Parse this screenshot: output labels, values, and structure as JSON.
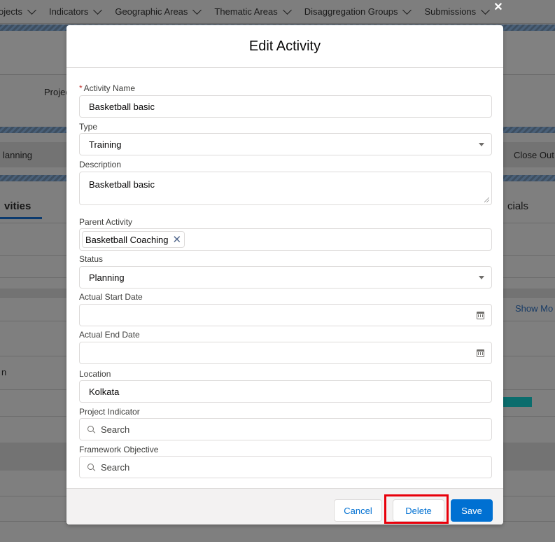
{
  "topnav": {
    "items": [
      "ojects",
      "Indicators",
      "Geographic Areas",
      "Thematic Areas",
      "Disaggregation Groups",
      "Submissions"
    ]
  },
  "background": {
    "project_label": "Projec",
    "stage_left": "lanning",
    "stage_right": "Close Out",
    "tab_left": "vities",
    "tab_right": "cials",
    "show_more": "Show Mo",
    "partial_char": "n"
  },
  "modal": {
    "title": "Edit Activity",
    "close_glyph": "✕",
    "fields": {
      "activity_name": {
        "label": "Activity Name",
        "required": "*",
        "value": "Basketball basic"
      },
      "type": {
        "label": "Type",
        "value": "Training"
      },
      "description": {
        "label": "Description",
        "value": "Basketball basic"
      },
      "parent_activity": {
        "label": "Parent Activity",
        "pill": "Basketball Coaching",
        "pill_remove": "✕"
      },
      "status": {
        "label": "Status",
        "value": "Planning"
      },
      "actual_start_date": {
        "label": "Actual Start Date",
        "value": ""
      },
      "actual_end_date": {
        "label": "Actual End Date",
        "value": ""
      },
      "location": {
        "label": "Location",
        "value": "Kolkata"
      },
      "project_indicator": {
        "label": "Project Indicator",
        "placeholder": "Search"
      },
      "framework_objective": {
        "label": "Framework Objective",
        "placeholder": "Search"
      }
    },
    "footer": {
      "cancel_label": "Cancel",
      "delete_label": "Delete",
      "save_label": "Save"
    }
  },
  "colors": {
    "brand": "#0070d2",
    "highlight": "#e8000b",
    "required": "#c23934"
  },
  "icons": [
    "chevron-down-icon",
    "close-icon",
    "calendar-icon",
    "search-icon",
    "remove-pill-icon",
    "select-arrow-icon"
  ]
}
